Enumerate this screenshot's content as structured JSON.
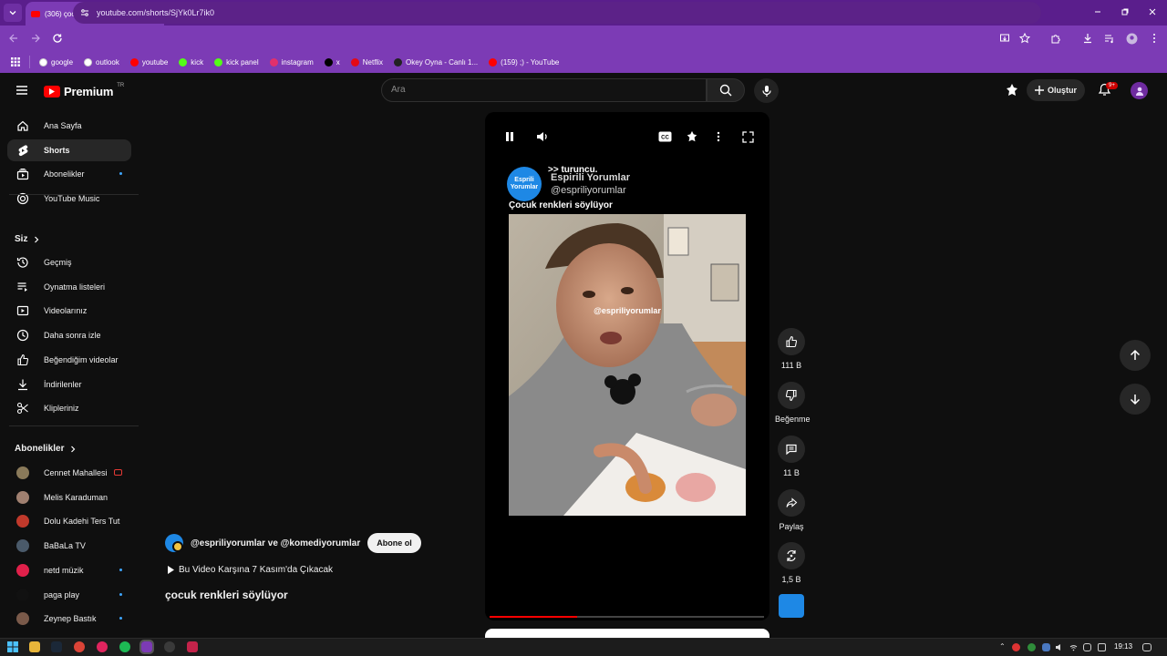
{
  "browser": {
    "tab_title": "(306) çocuk renkleri söylüyor",
    "url": "youtube.com/shorts/SjYk0Lr7ik0",
    "bookmarks": [
      {
        "label": "google",
        "icon": "google-icon",
        "color": "#ffffff"
      },
      {
        "label": "outlook",
        "icon": "outlook-icon",
        "color": "#ffffff"
      },
      {
        "label": "youtube",
        "icon": "youtube-icon",
        "color": "#ff0000"
      },
      {
        "label": "kick",
        "icon": "kick-icon",
        "color": "#53fc18"
      },
      {
        "label": "kick panel",
        "icon": "kick-icon",
        "color": "#53fc18"
      },
      {
        "label": "instagram",
        "icon": "instagram-icon",
        "color": "#e1306c"
      },
      {
        "label": "x",
        "icon": "x-icon",
        "color": "#000000"
      },
      {
        "label": "Netflix",
        "icon": "netflix-icon",
        "color": "#e50914"
      },
      {
        "label": "Okey Oyna - Canlı 1...",
        "icon": "okey-icon",
        "color": "#222222"
      },
      {
        "label": "(159) ;) - YouTube",
        "icon": "youtube-icon",
        "color": "#ff0000"
      }
    ]
  },
  "header": {
    "logo_text": "Premium",
    "logo_country": "TR",
    "search_placeholder": "Ara",
    "create_label": "Oluştur",
    "notification_count": "9+"
  },
  "sidebar": {
    "main": [
      {
        "label": "Ana Sayfa",
        "icon": "home-icon"
      },
      {
        "label": "Shorts",
        "icon": "shorts-icon",
        "active": true
      },
      {
        "label": "Abonelikler",
        "icon": "subscriptions-icon",
        "dot": true
      },
      {
        "label": "YouTube Music",
        "icon": "music-icon"
      }
    ],
    "you_heading": "Siz",
    "you": [
      {
        "label": "Geçmiş",
        "icon": "history-icon"
      },
      {
        "label": "Oynatma listeleri",
        "icon": "playlist-icon"
      },
      {
        "label": "Videolarınız",
        "icon": "your-videos-icon"
      },
      {
        "label": "Daha sonra izle",
        "icon": "watch-later-icon"
      },
      {
        "label": "Beğendiğim videolar",
        "icon": "like-icon"
      },
      {
        "label": "İndirilenler",
        "icon": "download-icon"
      },
      {
        "label": "Klipleriniz",
        "icon": "clip-icon"
      }
    ],
    "subs_heading": "Abonelikler",
    "subs": [
      {
        "label": "Cennet Mahallesi",
        "color": "#8a7a5a",
        "live": true
      },
      {
        "label": "Melis Karaduman",
        "color": "#a08070"
      },
      {
        "label": "Dolu Kadehi Ters Tut",
        "color": "#c0392b"
      },
      {
        "label": "BaBaLa TV",
        "color": "#4a5a6a"
      },
      {
        "label": "netd müzik",
        "color": "#e0204a",
        "dot": true
      },
      {
        "label": "paga play",
        "color": "#111111",
        "dot": true
      },
      {
        "label": "Zeynep Bastık",
        "color": "#7a5a4a",
        "dot": true
      }
    ]
  },
  "short": {
    "overlay_top": ">> turuncu.",
    "channel_display": "Espirili Yorumlar",
    "channel_handle": "@espriliyorumlar",
    "channel_avatar_text": "Esprili Yorumlar",
    "caption": "Çocuk renkleri söylüyor",
    "watermark": "@espriliyorumlar",
    "progress": 0.32
  },
  "actions": [
    {
      "icon": "like-icon",
      "label": "111 B"
    },
    {
      "icon": "dislike-icon",
      "label": "Beğenme"
    },
    {
      "icon": "comment-icon",
      "label": "11 B"
    },
    {
      "icon": "share-icon",
      "label": "Paylaş"
    },
    {
      "icon": "remix-icon",
      "label": "1,5 B"
    }
  ],
  "info": {
    "channels": "@espriliyorumlar ve @komediyorumlar",
    "subscribe_label": "Abone ol",
    "premiere": "Bu Video Karşına  7 Kasım'da Çıkacak",
    "title": "çocuk renkleri söylüyor"
  },
  "taskbar": {
    "time": "19:13"
  }
}
